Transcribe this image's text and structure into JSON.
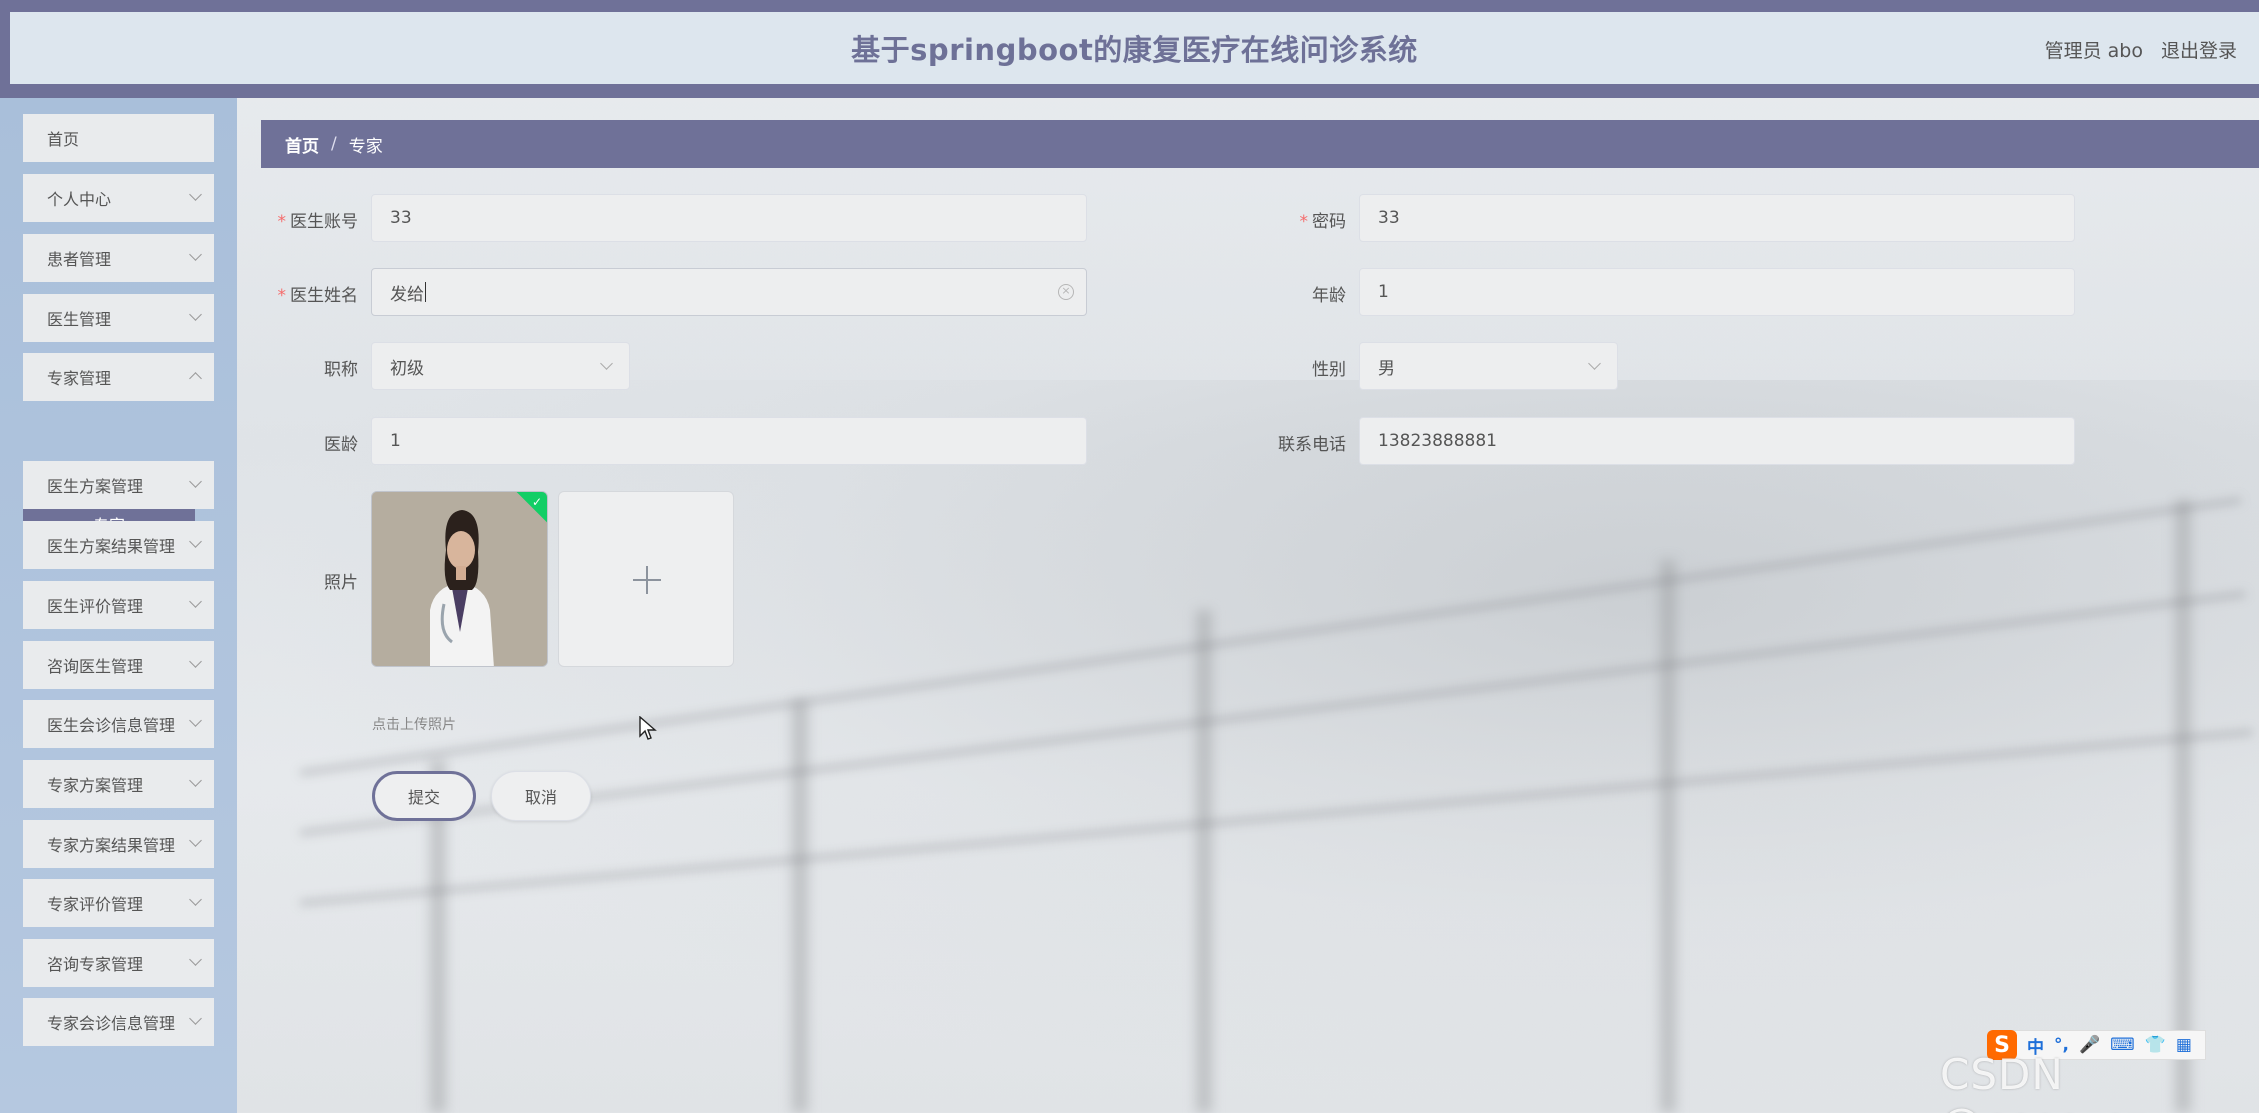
{
  "header": {
    "title": "基于springboot的康复医疗在线问诊系统",
    "user": "管理员 abo",
    "logout": "退出登录"
  },
  "sidebar": {
    "items": [
      {
        "label": "首页",
        "has_children": false
      },
      {
        "label": "个人中心",
        "has_children": true
      },
      {
        "label": "患者管理",
        "has_children": true
      },
      {
        "label": "医生管理",
        "has_children": true
      },
      {
        "label": "专家管理",
        "has_children": true
      },
      {
        "label": "医生方案管理",
        "has_children": true
      },
      {
        "label": "医生方案结果管理",
        "has_children": true
      },
      {
        "label": "医生评价管理",
        "has_children": true
      },
      {
        "label": "咨询医生管理",
        "has_children": true
      },
      {
        "label": "医生会诊信息管理",
        "has_children": true
      },
      {
        "label": "专家方案管理",
        "has_children": true
      },
      {
        "label": "专家方案结果管理",
        "has_children": true
      },
      {
        "label": "专家评价管理",
        "has_children": true
      },
      {
        "label": "咨询专家管理",
        "has_children": true
      },
      {
        "label": "专家会诊信息管理",
        "has_children": true
      }
    ],
    "submenu": {
      "label": "专家"
    }
  },
  "breadcrumb": {
    "home": "首页",
    "separator": "/",
    "current": "专家"
  },
  "form": {
    "account": {
      "label": "医生账号",
      "value": "33",
      "required": true
    },
    "password": {
      "label": "密码",
      "value": "33",
      "required": true
    },
    "name": {
      "label": "医生姓名",
      "value": "发给",
      "required": true
    },
    "age": {
      "label": "年龄",
      "value": "1"
    },
    "title": {
      "label": "职称",
      "value": "初级"
    },
    "gender": {
      "label": "性别",
      "value": "男"
    },
    "experience": {
      "label": "医龄",
      "value": "1"
    },
    "phone": {
      "label": "联系电话",
      "value": "13823888881"
    },
    "photo": {
      "label": "照片",
      "hint": "点击上传照片"
    },
    "required_mark": "*"
  },
  "buttons": {
    "submit": "提交",
    "cancel": "取消"
  },
  "ime": {
    "logo": "S",
    "mode": "中",
    "punct": "°,"
  },
  "watermark": "CSDN @cccc_cz",
  "colors": {
    "accent": "#6f7198",
    "success": "#13ce66",
    "required": "#f56c6c"
  }
}
